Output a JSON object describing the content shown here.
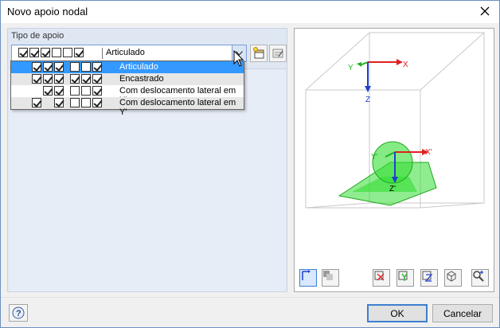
{
  "window": {
    "title": "Novo apoio nodal"
  },
  "support_type": {
    "header": "Tipo de apoio",
    "selected": {
      "checks": [
        true,
        true,
        true,
        false,
        false,
        true
      ],
      "label": "Articulado"
    },
    "options": [
      {
        "label": "Articulado",
        "checks": [
          true,
          true,
          true,
          false,
          false,
          true
        ],
        "state": "selected"
      },
      {
        "label": "Encastrado",
        "checks": [
          true,
          true,
          true,
          true,
          true,
          true
        ],
        "state": "alt"
      },
      {
        "label": "Com deslocamento lateral em X'",
        "checks": [
          false,
          true,
          true,
          false,
          false,
          true
        ],
        "state": "normal"
      },
      {
        "label": "Com deslocamento lateral em Y'",
        "checks": [
          true,
          false,
          true,
          false,
          false,
          true
        ],
        "state": "alt"
      }
    ]
  },
  "view3d": {
    "global_axes": {
      "x": "X",
      "y": "Y",
      "z": "Z"
    },
    "local_axes": {
      "x": "X'",
      "y": "Y'",
      "z": "Z'"
    },
    "colors": {
      "x_axis": "#e02020",
      "y_axis": "#20b020",
      "z_axis": "#1f3fd0",
      "support": "#33dd33"
    }
  },
  "buttons": {
    "ok": "OK",
    "cancel": "Cancelar"
  },
  "icons": {
    "close": "close-icon",
    "help": "help-icon",
    "new_support": "new-support-icon",
    "edit_support": "edit-support-icon",
    "axis_view": "axis-view-icon",
    "render_mode": "render-mode-icon",
    "view_x": "view-x-icon",
    "view_y": "view-y-icon",
    "view_z": "view-z-icon",
    "view_iso": "view-iso-icon",
    "view_settings": "view-settings-icon"
  }
}
